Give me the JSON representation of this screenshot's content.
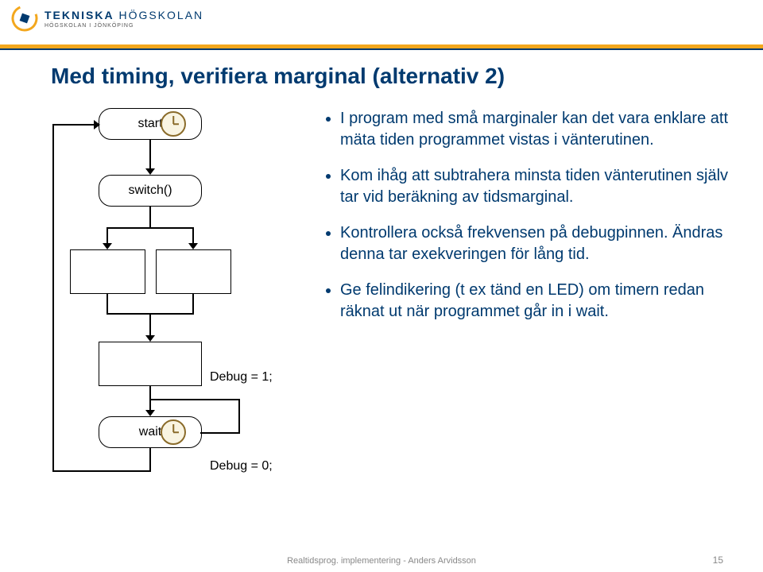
{
  "logo": {
    "line1a": "TEKNISKA",
    "line1b": " HÖGSKOLAN",
    "line2": "HÖGSKOLAN I JÖNKÖPING"
  },
  "title": "Med timing, verifiera marginal (alternativ 2)",
  "diagram": {
    "start": "start",
    "switch": "switch()",
    "wait": "wait",
    "debug1": "Debug = 1;",
    "debug0": "Debug = 0;"
  },
  "bullets": [
    "I program med små marginaler kan det vara enklare att mäta tiden programmet vistas i vänterutinen.",
    "Kom ihåg att subtrahera minsta tiden vänterutinen själv tar vid beräkning av tidsmarginal.",
    "Kontrollera också frekvensen på debugpinnen. Ändras denna tar exekveringen för lång tid.",
    "Ge felindikering (t ex tänd en LED) om timern redan räknat ut när programmet går in i wait."
  ],
  "footer": "Realtidsprog. implementering - Anders Arvidsson",
  "page_number": "15"
}
